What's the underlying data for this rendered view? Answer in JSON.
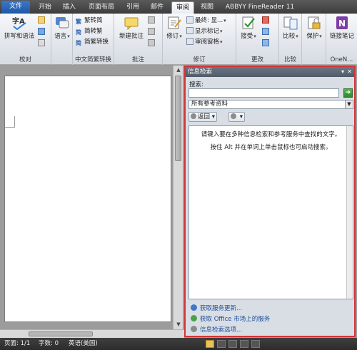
{
  "tabs": [
    "文件",
    "开始",
    "插入",
    "页面布局",
    "引用",
    "邮件",
    "审阅",
    "视图",
    "ABBYY FineReader 11"
  ],
  "active_tab": "审阅",
  "ribbon": {
    "proofing": {
      "spell_label": "拼写和语法",
      "group_label": "校对"
    },
    "language": {
      "label": "语言"
    },
    "chinese_conv": {
      "to_trad": "繁转简",
      "to_simp": "简转繁",
      "conv": "简繁转换",
      "group_label": "中文简繁转换"
    },
    "comments": {
      "new_comment": "新建批注",
      "group_label": "批注"
    },
    "tracking": {
      "track": "修订",
      "final": "最终: 显...",
      "show_markup": "显示标记",
      "review_pane": "审阅窗格",
      "group_label": "修订"
    },
    "changes": {
      "accept": "接受",
      "group_label": "更改"
    },
    "compare": {
      "compare": "比较",
      "group_label": "比较"
    },
    "protect": {
      "protect": "保护"
    },
    "onenote": {
      "linked_notes": "链接笔记",
      "group_label": "OneN..."
    }
  },
  "research_pane": {
    "title": "信息检索",
    "search_label": "搜索:",
    "search_value": "",
    "source_selected": "所有参考资料",
    "back_label": "返回",
    "result_line1": "请键入要在多种信息检索和参考服务中查找的文字。",
    "result_line2": "按住 Alt 并在单词上单击鼠标也可启动搜索。",
    "links": [
      "获取服务更新...",
      "获取 Office 市场上的服务",
      "信息检索选项..."
    ]
  },
  "status": {
    "page": "页面: 1/1",
    "words": "字数: 0",
    "lang": "英语(美国)"
  },
  "colors": {
    "highlight_border": "#d1343a",
    "file_tab": "#2b62b3",
    "status_bg": "#333333"
  }
}
